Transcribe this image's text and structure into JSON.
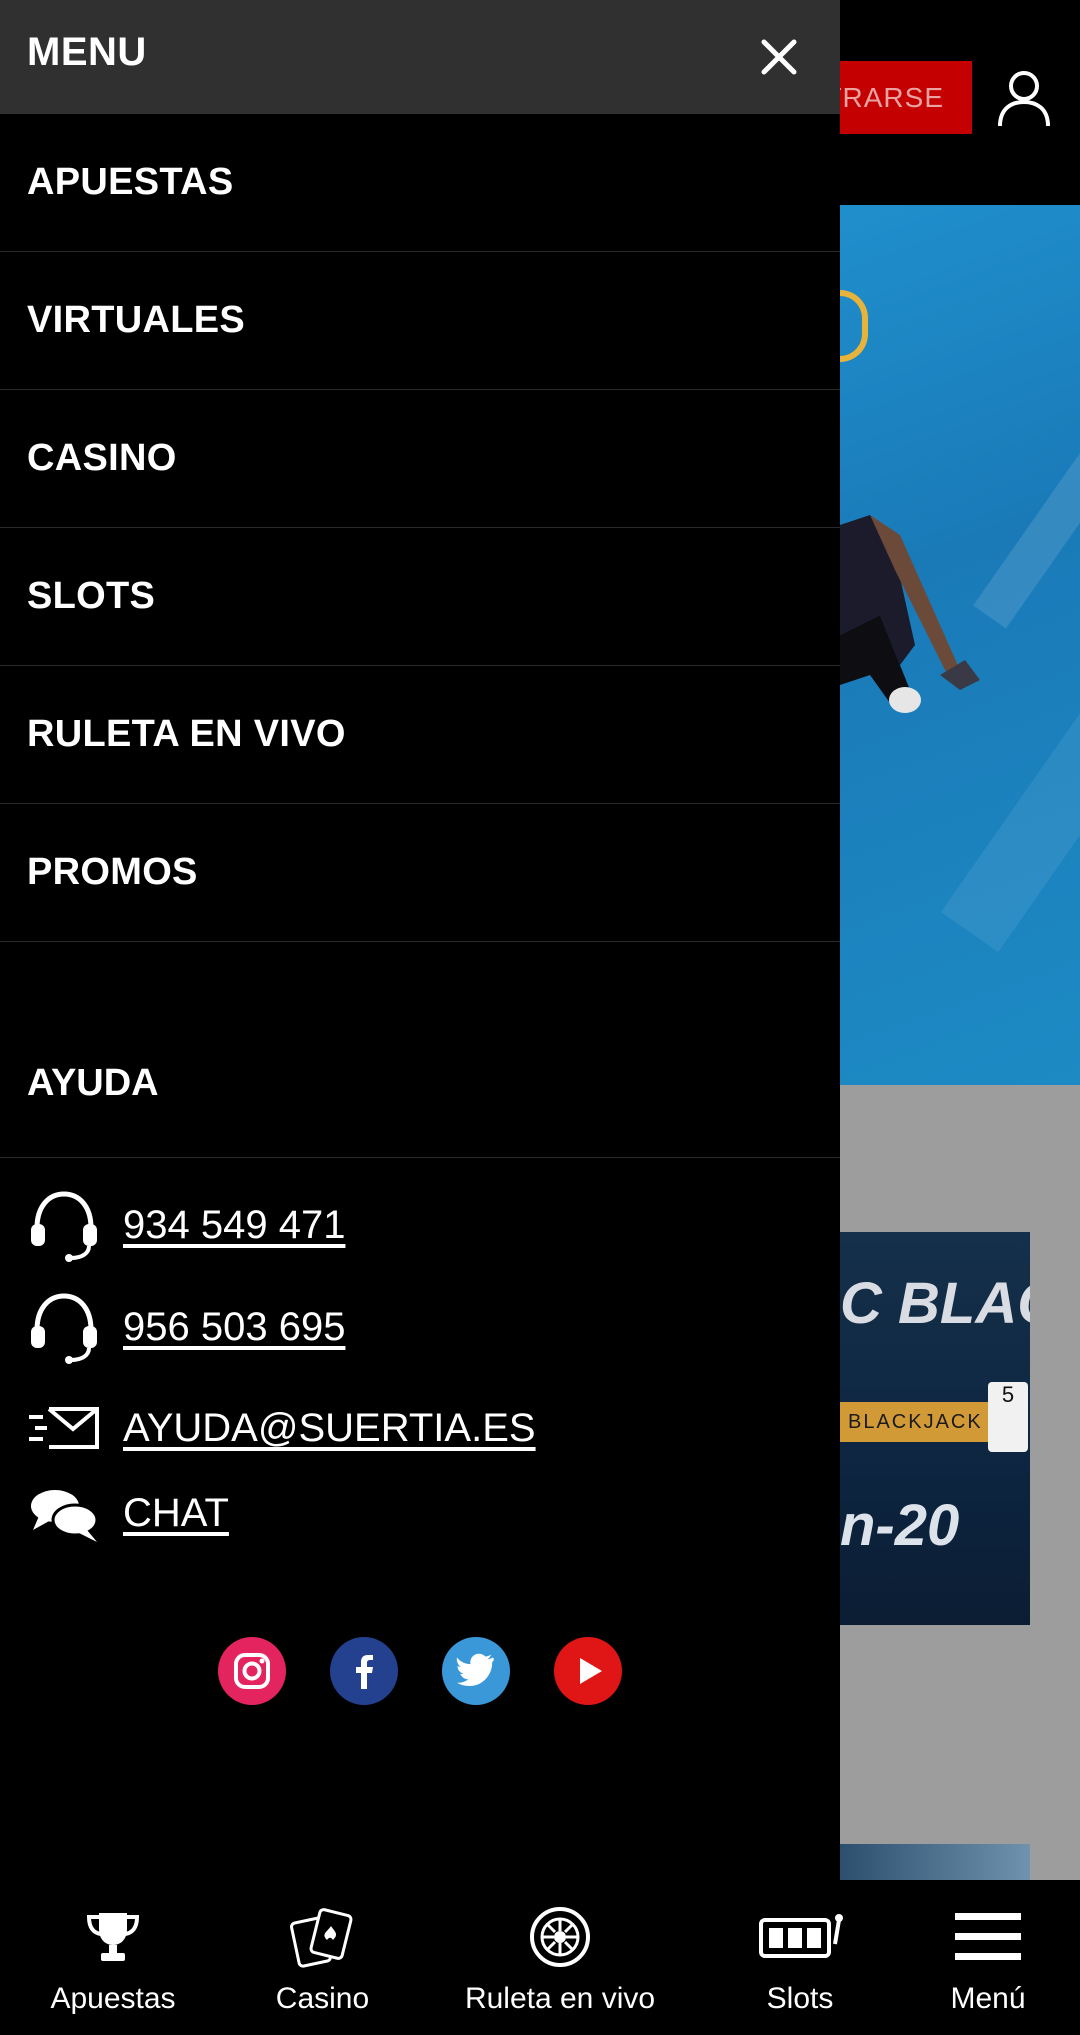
{
  "header": {
    "register_label": "TRARSE"
  },
  "drawer": {
    "title": "MENU",
    "items": [
      {
        "label": "APUESTAS"
      },
      {
        "label": "VIRTUALES"
      },
      {
        "label": "CASINO"
      },
      {
        "label": "SLOTS"
      },
      {
        "label": "RULETA EN VIVO"
      },
      {
        "label": "PROMOS"
      }
    ],
    "help": {
      "title": "AYUDA",
      "phone1": "934 549 471",
      "phone2": "956 503 695",
      "email": "AYUDA@SUERTIA.ES",
      "chat": "CHAT"
    },
    "social": [
      "instagram-icon",
      "facebook-icon",
      "twitter-icon",
      "youtube-icon"
    ]
  },
  "promo": {
    "title_line": "C BLACKJA",
    "ribbon": "BLACKJACK",
    "card_rank": "5",
    "subtitle": "n-20"
  },
  "bottom_nav": [
    {
      "label": "Apuestas",
      "icon": "trophy-icon"
    },
    {
      "label": "Casino",
      "icon": "cards-icon"
    },
    {
      "label": "Ruleta en vivo",
      "icon": "roulette-icon"
    },
    {
      "label": "Slots",
      "icon": "slot-machine-icon"
    },
    {
      "label": "Menú",
      "icon": "hamburger-icon"
    }
  ],
  "colors": {
    "accent": "#c40000",
    "drawer_header": "#303030",
    "hero": "#1f8fcc"
  }
}
